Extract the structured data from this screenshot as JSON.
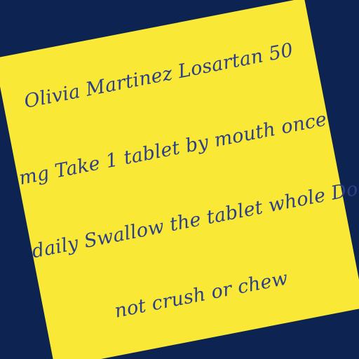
{
  "colors": {
    "background": "#0d2452",
    "note": "#f9e936",
    "ink": "#2b3f86"
  },
  "note": {
    "lines": [
      "Olivia Martinez Losartan 50",
      "mg Take 1 tablet by mouth once",
      "daily Swallow the tablet whole Do",
      "not crush or chew"
    ]
  }
}
